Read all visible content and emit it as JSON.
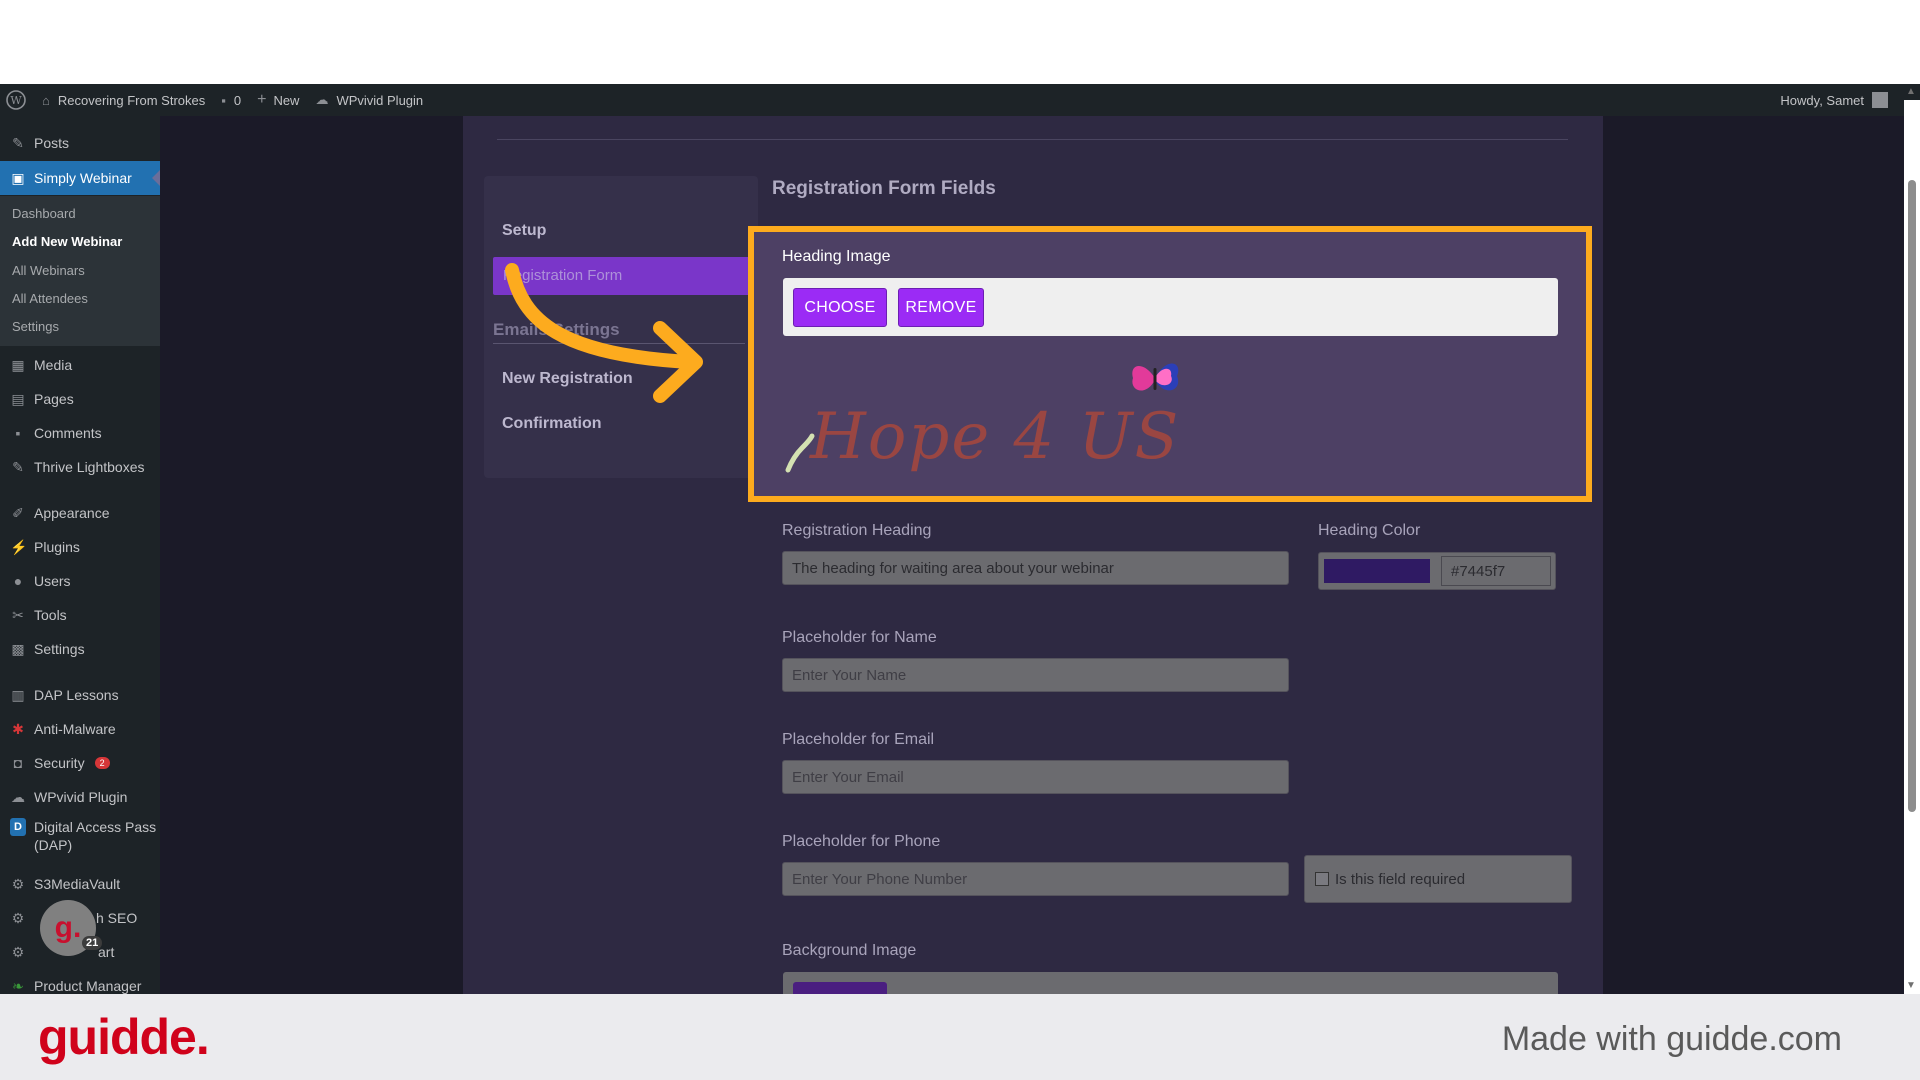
{
  "adminbar": {
    "site_name": "Recovering From Strokes",
    "comments_count": "0",
    "new_label": "New",
    "plugin_label": "WPvivid Plugin",
    "howdy": "Howdy, Samet"
  },
  "sidebar": {
    "items": [
      {
        "label": "Posts",
        "icon": "pushpin-icon"
      },
      {
        "label": "Simply Webinar",
        "icon": "webinar-icon"
      },
      {
        "label": "Media",
        "icon": "media-icon"
      },
      {
        "label": "Pages",
        "icon": "pages-icon"
      },
      {
        "label": "Comments",
        "icon": "comment-icon"
      },
      {
        "label": "Thrive Lightboxes",
        "icon": "pushpin-icon"
      },
      {
        "label": "Appearance",
        "icon": "brush-icon"
      },
      {
        "label": "Plugins",
        "icon": "plugin-icon"
      },
      {
        "label": "Users",
        "icon": "user-icon"
      },
      {
        "label": "Tools",
        "icon": "wrench-icon"
      },
      {
        "label": "Settings",
        "icon": "settings-icon"
      },
      {
        "label": "DAP Lessons",
        "icon": "book-icon"
      },
      {
        "label": "Anti-Malware",
        "icon": "shield-icon"
      },
      {
        "label": "Security",
        "icon": "lock-icon",
        "badge": "2"
      },
      {
        "label": "WPvivid Plugin",
        "icon": "cloud-icon"
      },
      {
        "label": "Digital Access Pass",
        "label2": "(DAP)",
        "icon": "dap-icon"
      },
      {
        "label": "S3MediaVault",
        "icon": "gear-icon"
      },
      {
        "label": "h SEO",
        "icon": "gear-icon"
      },
      {
        "label": "art",
        "icon": "gear-icon"
      },
      {
        "label": "Product Manager",
        "icon": "leaf-icon"
      }
    ],
    "submenu": [
      "Dashboard",
      "Add New Webinar",
      "All Webinars",
      "All Attendees",
      "Settings"
    ]
  },
  "settings_nav": {
    "setup": "Setup",
    "registration_form": "Registration Form",
    "emails_settings": "Emails Settings",
    "new_registration": "New Registration",
    "confirmation": "Confirmation"
  },
  "form": {
    "section_title": "Registration Form Fields",
    "heading_image_label": "Heading Image",
    "choose_label": "CHOOSE",
    "remove_label": "REMOVE",
    "heading_image_text": "Hope 4 US",
    "registration_heading_label": "Registration Heading",
    "registration_heading_value": "The heading for waiting area about your webinar",
    "heading_color_label": "Heading Color",
    "heading_color_value": "#7445f7",
    "name_label": "Placeholder for Name",
    "name_value": "Enter Your Name",
    "email_label": "Placeholder for Email",
    "email_value": "Enter Your Email",
    "phone_label": "Placeholder for Phone",
    "phone_value": "Enter Your Phone Number",
    "required_label": "Is this field required",
    "background_image_label": "Background Image"
  },
  "guidde": {
    "badge_letter": "g.",
    "badge_count": "21",
    "logo": "guidde.",
    "made_with": "Made with guidde.com"
  },
  "colors": {
    "highlight": "#fdab1e",
    "button_purple": "#9b2bf5",
    "wp_active": "#2271b1",
    "guidde_red": "#d0021b"
  }
}
